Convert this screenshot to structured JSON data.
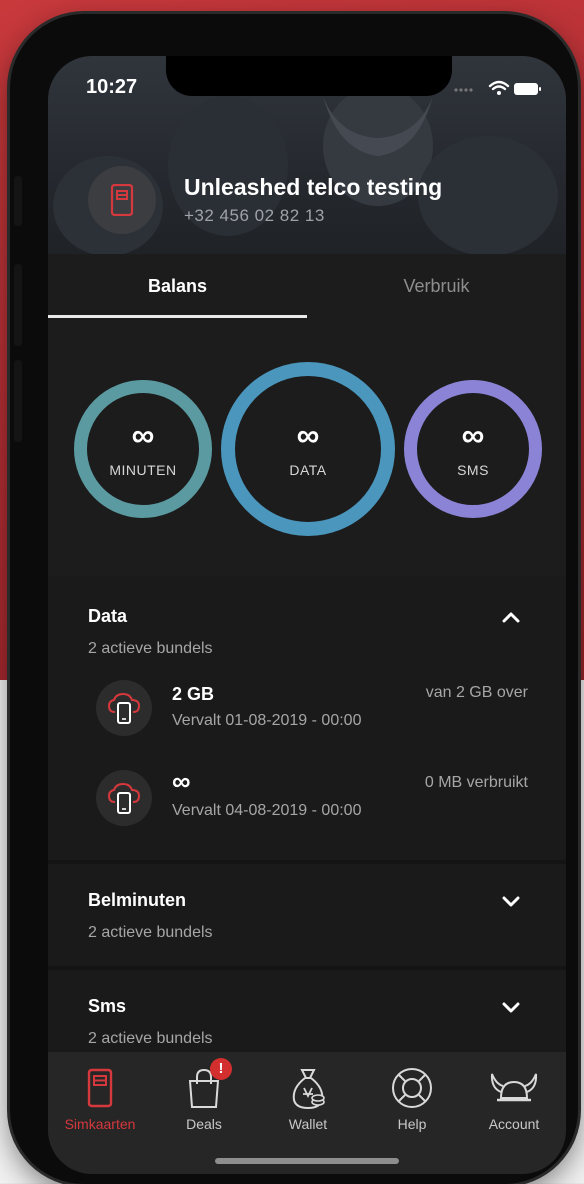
{
  "status": {
    "time": "10:27"
  },
  "account": {
    "name": "Unleashed telco testing",
    "number": "+32 456 02 82 13"
  },
  "tabs": [
    {
      "label": "Balans",
      "active": true
    },
    {
      "label": "Verbruik",
      "active": false
    }
  ],
  "rings": [
    {
      "value": "∞",
      "label": "MINUTEN",
      "color": "#5a9aa0"
    },
    {
      "value": "∞",
      "label": "DATA",
      "color": "#4b96bd"
    },
    {
      "value": "∞",
      "label": "SMS",
      "color": "#8b84d6"
    }
  ],
  "sections": {
    "data": {
      "title": "Data",
      "subtitle": "2 actieve bundels",
      "expanded": true,
      "bundles": [
        {
          "amount": "2 GB",
          "expiry": "Vervalt 01-08-2019 - 00:00",
          "status": "van 2 GB over",
          "icon": "cloud-phone-icon"
        },
        {
          "amount": "∞",
          "expiry": "Vervalt 04-08-2019 - 00:00",
          "status": "0 MB verbruikt",
          "icon": "cloud-phone-icon"
        }
      ]
    },
    "belminuten": {
      "title": "Belminuten",
      "subtitle": "2 actieve bundels",
      "expanded": false
    },
    "sms": {
      "title": "Sms",
      "subtitle": "2 actieve bundels",
      "expanded": false
    }
  },
  "tabbar": {
    "items": [
      {
        "label": "Simkaarten",
        "icon": "sim-card-icon",
        "active": true
      },
      {
        "label": "Deals",
        "icon": "shopping-bag-icon",
        "active": false,
        "badge": "!"
      },
      {
        "label": "Wallet",
        "icon": "money-bag-icon",
        "active": false
      },
      {
        "label": "Help",
        "icon": "lifebuoy-icon",
        "active": false
      },
      {
        "label": "Account",
        "icon": "viking-helmet-icon",
        "active": false
      }
    ]
  },
  "colors": {
    "accent": "#d5383d",
    "background": "#1c1c1c"
  }
}
